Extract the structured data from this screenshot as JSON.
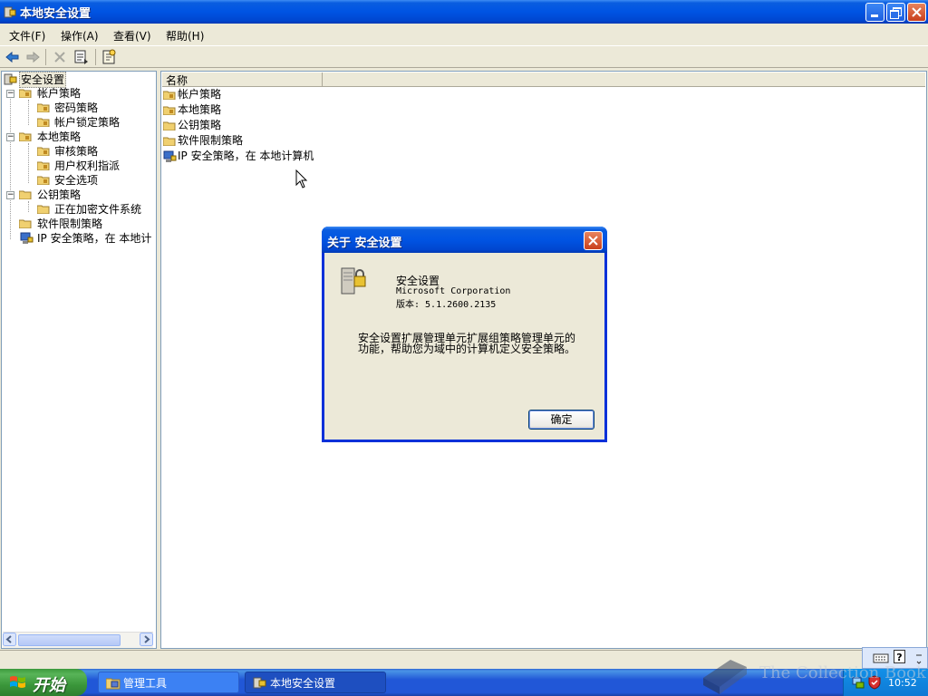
{
  "window": {
    "title": "本地安全设置"
  },
  "menu": [
    "文件(F)",
    "操作(A)",
    "查看(V)",
    "帮助(H)"
  ],
  "tree": {
    "root": "安全设置",
    "nodes": [
      "帐户策略",
      "密码策略",
      "帐户锁定策略",
      "本地策略",
      "审核策略",
      "用户权利指派",
      "安全选项",
      "公钥策略",
      "正在加密文件系统",
      "软件限制策略",
      "IP 安全策略，在 本地计"
    ]
  },
  "list": {
    "column": "名称",
    "items": [
      "帐户策略",
      "本地策略",
      "公钥策略",
      "软件限制策略",
      "IP 安全策略，在 本地计算机"
    ]
  },
  "dialog": {
    "title": "关于 安全设置",
    "product": "安全设置",
    "company": "Microsoft Corporation",
    "version": "版本: 5.1.2600.2135",
    "desc1": "安全设置扩展管理单元扩展组策略管理单元的",
    "desc2": "功能，帮助您为域中的计算机定义安全策略。",
    "ok": "确定"
  },
  "taskbar": {
    "start": "开始",
    "tasks": [
      "管理工具",
      "本地安全设置"
    ],
    "clock": "10:52"
  },
  "watermark": "The Collection Book"
}
